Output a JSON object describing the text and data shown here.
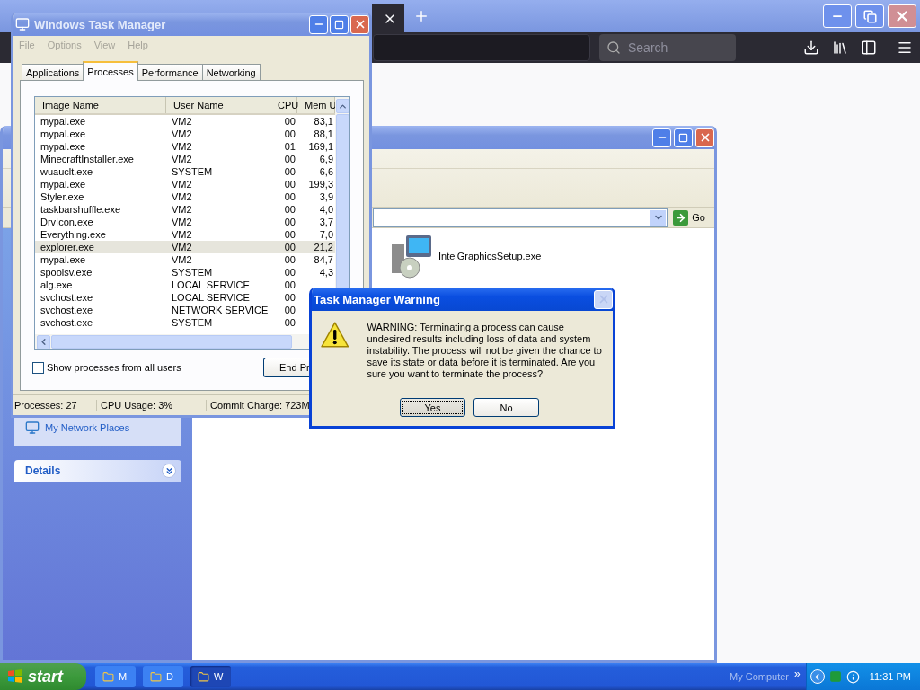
{
  "browser": {
    "search": {
      "placeholder": "Search"
    }
  },
  "explorer": {
    "sidebar": {
      "link": "My Network Places",
      "details": "Details"
    },
    "address": {
      "go": "Go"
    },
    "files": [
      {
        "name": "IntelGraphicsSetup.exe"
      }
    ]
  },
  "task_manager": {
    "title": "Windows Task Manager",
    "menu": [
      "File",
      "Options",
      "View",
      "Help"
    ],
    "tabs": [
      {
        "label": "Applications",
        "selected": false
      },
      {
        "label": "Processes",
        "selected": true
      },
      {
        "label": "Performance",
        "selected": false
      },
      {
        "label": "Networking",
        "selected": false
      }
    ],
    "columns": [
      "Image Name",
      "User Name",
      "CPU",
      "Mem U"
    ],
    "rows": [
      {
        "image": "mypal.exe",
        "user": "VM2",
        "cpu": "00",
        "mem": "83,1",
        "selected": false
      },
      {
        "image": "mypal.exe",
        "user": "VM2",
        "cpu": "00",
        "mem": "88,1",
        "selected": false
      },
      {
        "image": "mypal.exe",
        "user": "VM2",
        "cpu": "01",
        "mem": "169,1",
        "selected": false
      },
      {
        "image": "MinecraftInstaller.exe",
        "user": "VM2",
        "cpu": "00",
        "mem": "6,9",
        "selected": false
      },
      {
        "image": "wuauclt.exe",
        "user": "SYSTEM",
        "cpu": "00",
        "mem": "6,6",
        "selected": false
      },
      {
        "image": "mypal.exe",
        "user": "VM2",
        "cpu": "00",
        "mem": "199,3",
        "selected": false
      },
      {
        "image": "Styler.exe",
        "user": "VM2",
        "cpu": "00",
        "mem": "3,9",
        "selected": false
      },
      {
        "image": "taskbarshuffle.exe",
        "user": "VM2",
        "cpu": "00",
        "mem": "4,0",
        "selected": false
      },
      {
        "image": "DrvIcon.exe",
        "user": "VM2",
        "cpu": "00",
        "mem": "3,7",
        "selected": false
      },
      {
        "image": "Everything.exe",
        "user": "VM2",
        "cpu": "00",
        "mem": "7,0",
        "selected": false
      },
      {
        "image": "explorer.exe",
        "user": "VM2",
        "cpu": "00",
        "mem": "21,2",
        "selected": true
      },
      {
        "image": "mypal.exe",
        "user": "VM2",
        "cpu": "00",
        "mem": "84,7",
        "selected": false
      },
      {
        "image": "spoolsv.exe",
        "user": "SYSTEM",
        "cpu": "00",
        "mem": "4,3",
        "selected": false
      },
      {
        "image": "alg.exe",
        "user": "LOCAL SERVICE",
        "cpu": "00",
        "selected": false
      },
      {
        "image": "svchost.exe",
        "user": "LOCAL SERVICE",
        "cpu": "00",
        "selected": false
      },
      {
        "image": "svchost.exe",
        "user": "NETWORK SERVICE",
        "cpu": "00",
        "selected": false
      },
      {
        "image": "svchost.exe",
        "user": "SYSTEM",
        "cpu": "00",
        "selected": false
      }
    ],
    "show_all_users": {
      "label": "Show processes from all users",
      "checked": false
    },
    "end_button": "End Pr",
    "status": [
      "Processes: 27",
      "CPU Usage: 3%",
      "Commit Charge: 723M"
    ]
  },
  "dialog": {
    "title": "Task Manager Warning",
    "message": "WARNING: Terminating a process can cause undesired results including loss of data and system instability. The process will not be given the chance to save its state or data before it is terminated.  Are you sure you want to terminate the process?",
    "buttons": [
      {
        "label": "Yes",
        "default": true
      },
      {
        "label": "No",
        "default": false
      }
    ]
  },
  "taskbar": {
    "start": "start",
    "tasks": [
      {
        "label": "M",
        "selected": false
      },
      {
        "label": "D",
        "selected": false
      },
      {
        "label": "W",
        "selected": true
      }
    ],
    "toolbar": "My Computer",
    "chevron": "»",
    "clock": "11:31 PM"
  }
}
